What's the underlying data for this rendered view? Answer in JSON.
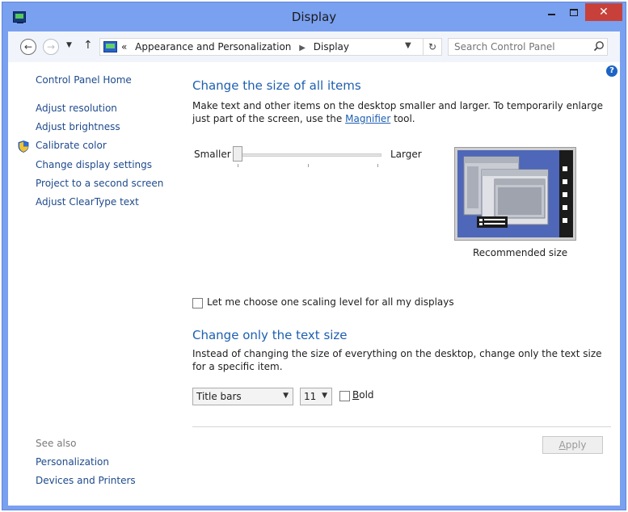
{
  "window": {
    "title": "Display"
  },
  "nav": {
    "breadcrumb_prefix": "«",
    "breadcrumb": [
      "Appearance and Personalization",
      "Display"
    ],
    "search_placeholder": "Search Control Panel"
  },
  "sidebar": {
    "home": "Control Panel Home",
    "items": [
      {
        "label": "Adjust resolution"
      },
      {
        "label": "Adjust brightness"
      },
      {
        "label": "Calibrate color",
        "icon": "shield-icon"
      },
      {
        "label": "Change display settings"
      },
      {
        "label": "Project to a second screen"
      },
      {
        "label": "Adjust ClearType text"
      }
    ],
    "see_also_title": "See also",
    "see_also": [
      {
        "label": "Personalization"
      },
      {
        "label": "Devices and Printers"
      }
    ]
  },
  "main": {
    "section1_title": "Change the size of all items",
    "section1_desc_before": "Make text and other items on the desktop smaller and larger. To temporarily enlarge just part of the screen, use the ",
    "section1_desc_link": "Magnifier",
    "section1_desc_after": " tool.",
    "slider": {
      "min_label": "Smaller",
      "max_label": "Larger",
      "level": 0
    },
    "preview_caption": "Recommended size",
    "scaling_checkbox": {
      "label": "Let me choose one scaling level for all my displays",
      "checked": false
    },
    "section2_title": "Change only the text size",
    "section2_desc": "Instead of changing the size of everything on the desktop, change only the text size for a specific item.",
    "item_select": {
      "value": "Title bars"
    },
    "size_select": {
      "value": "11"
    },
    "bold_checkbox": {
      "label_u": "B",
      "label_rest": "old",
      "checked": false
    },
    "apply_button": {
      "label_u": "A",
      "label_rest": "pply",
      "enabled": false
    }
  },
  "colors": {
    "title_bar": "#7aa0f0",
    "close_button": "#c7413a",
    "heading": "#1d5fb0",
    "link": "#1e4a8c"
  }
}
